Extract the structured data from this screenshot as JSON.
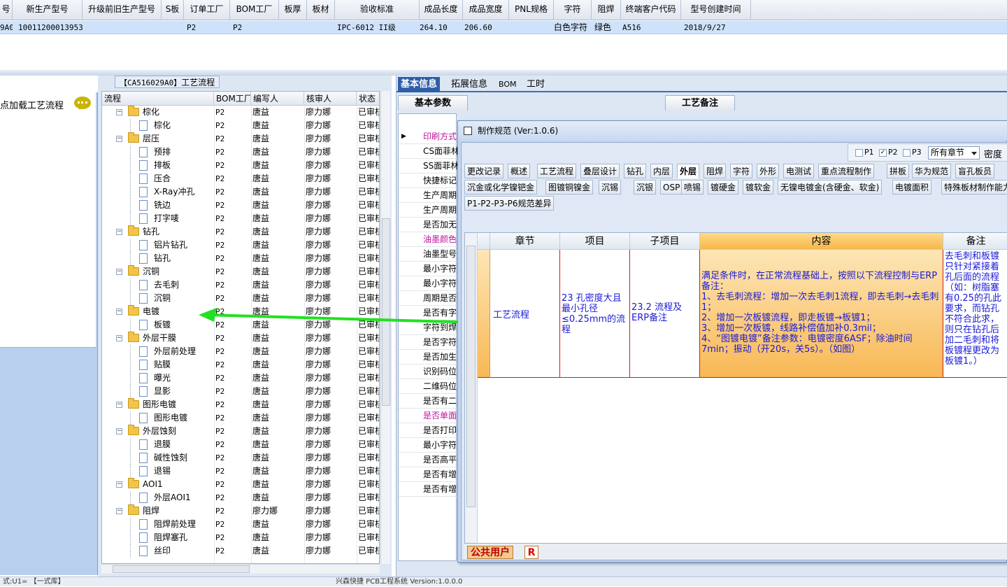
{
  "top_grid": {
    "headers": [
      "号",
      "新生产型号",
      "升级前旧生产型号",
      "S板",
      "订单工厂",
      "BOM工厂",
      "板厚",
      "板材",
      "验收标准",
      "成品长度",
      "成品宽度",
      "PNL规格",
      "字符",
      "阻焊",
      "终端客户代码",
      "型号创建时间"
    ],
    "row": [
      "9A0",
      "10011200013953",
      "",
      "",
      "P2",
      "P2",
      "",
      "",
      "IPC-6012 II级",
      "264.10",
      "206.60",
      "",
      "白色字符",
      "绿色",
      "A516",
      "2018/9/27"
    ]
  },
  "left_panel": {
    "title": "点加载工艺流程"
  },
  "tree": {
    "caption_code": "【CA516029A0】",
    "caption_text": "工艺流程",
    "headers": [
      "流程",
      "BOM工厂",
      "编写人",
      "核审人",
      "状态"
    ],
    "rows": [
      {
        "name": "棕化",
        "type": "folder",
        "bom": "P2",
        "writer": "唐益",
        "reviewer": "廖力娜",
        "status": "已审核"
      },
      {
        "name": "棕化",
        "type": "doc",
        "bom": "P2",
        "writer": "唐益",
        "reviewer": "廖力娜",
        "status": "已审核"
      },
      {
        "name": "层压",
        "type": "folder",
        "bom": "P2",
        "writer": "唐益",
        "reviewer": "廖力娜",
        "status": "已审核"
      },
      {
        "name": "预排",
        "type": "doc",
        "bom": "P2",
        "writer": "唐益",
        "reviewer": "廖力娜",
        "status": "已审核"
      },
      {
        "name": "排板",
        "type": "doc",
        "bom": "P2",
        "writer": "唐益",
        "reviewer": "廖力娜",
        "status": "已审核"
      },
      {
        "name": "压合",
        "type": "doc",
        "bom": "P2",
        "writer": "唐益",
        "reviewer": "廖力娜",
        "status": "已审核"
      },
      {
        "name": "X-Ray冲孔",
        "type": "doc",
        "bom": "P2",
        "writer": "唐益",
        "reviewer": "廖力娜",
        "status": "已审核"
      },
      {
        "name": "铣边",
        "type": "doc",
        "bom": "P2",
        "writer": "唐益",
        "reviewer": "廖力娜",
        "status": "已审核"
      },
      {
        "name": "打字唛",
        "type": "doc",
        "bom": "P2",
        "writer": "唐益",
        "reviewer": "廖力娜",
        "status": "已审核"
      },
      {
        "name": "钻孔",
        "type": "folder",
        "bom": "P2",
        "writer": "唐益",
        "reviewer": "廖力娜",
        "status": "已审核"
      },
      {
        "name": "铝片钻孔",
        "type": "doc",
        "bom": "P2",
        "writer": "唐益",
        "reviewer": "廖力娜",
        "status": "已审核"
      },
      {
        "name": "钻孔",
        "type": "doc",
        "bom": "P2",
        "writer": "唐益",
        "reviewer": "廖力娜",
        "status": "已审核"
      },
      {
        "name": "沉铜",
        "type": "folder",
        "bom": "P2",
        "writer": "唐益",
        "reviewer": "廖力娜",
        "status": "已审核"
      },
      {
        "name": "去毛刺",
        "type": "doc",
        "bom": "P2",
        "writer": "唐益",
        "reviewer": "廖力娜",
        "status": "已审核"
      },
      {
        "name": "沉铜",
        "type": "doc",
        "bom": "P2",
        "writer": "唐益",
        "reviewer": "廖力娜",
        "status": "已审核"
      },
      {
        "name": "电镀",
        "type": "folder",
        "bom": "P2",
        "writer": "唐益",
        "reviewer": "廖力娜",
        "status": "已审核"
      },
      {
        "name": "板镀",
        "type": "doc",
        "bom": "P2",
        "writer": "唐益",
        "reviewer": "廖力娜",
        "status": "已审核"
      },
      {
        "name": "外层干膜",
        "type": "folder",
        "bom": "P2",
        "writer": "唐益",
        "reviewer": "廖力娜",
        "status": "已审核"
      },
      {
        "name": "外层前处理",
        "type": "doc",
        "bom": "P2",
        "writer": "唐益",
        "reviewer": "廖力娜",
        "status": "已审核"
      },
      {
        "name": "贴膜",
        "type": "doc",
        "bom": "P2",
        "writer": "唐益",
        "reviewer": "廖力娜",
        "status": "已审核"
      },
      {
        "name": "曝光",
        "type": "doc",
        "bom": "P2",
        "writer": "唐益",
        "reviewer": "廖力娜",
        "status": "已审核"
      },
      {
        "name": "显影",
        "type": "doc",
        "bom": "P2",
        "writer": "唐益",
        "reviewer": "廖力娜",
        "status": "已审核"
      },
      {
        "name": "图形电镀",
        "type": "folder",
        "bom": "P2",
        "writer": "唐益",
        "reviewer": "廖力娜",
        "status": "已审核"
      },
      {
        "name": "图形电镀",
        "type": "doc",
        "bom": "P2",
        "writer": "唐益",
        "reviewer": "廖力娜",
        "status": "已审核"
      },
      {
        "name": "外层蚀刻",
        "type": "folder",
        "bom": "P2",
        "writer": "唐益",
        "reviewer": "廖力娜",
        "status": "已审核"
      },
      {
        "name": "退膜",
        "type": "doc",
        "bom": "P2",
        "writer": "唐益",
        "reviewer": "廖力娜",
        "status": "已审核"
      },
      {
        "name": "碱性蚀刻",
        "type": "doc",
        "bom": "P2",
        "writer": "唐益",
        "reviewer": "廖力娜",
        "status": "已审核"
      },
      {
        "name": "退锡",
        "type": "doc",
        "bom": "P2",
        "writer": "唐益",
        "reviewer": "廖力娜",
        "status": "已审核"
      },
      {
        "name": "AOI1",
        "type": "folder",
        "bom": "P2",
        "writer": "唐益",
        "reviewer": "廖力娜",
        "status": "已审核"
      },
      {
        "name": "外层AOI1",
        "type": "doc",
        "bom": "P2",
        "writer": "唐益",
        "reviewer": "廖力娜",
        "status": "已审核"
      },
      {
        "name": "阻焊",
        "type": "folder",
        "bom": "P2",
        "writer": "廖力娜",
        "reviewer": "廖力娜",
        "status": "已审核"
      },
      {
        "name": "阻焊前处理",
        "type": "doc",
        "bom": "P2",
        "writer": "唐益",
        "reviewer": "廖力娜",
        "status": "已审核"
      },
      {
        "name": "阻焊塞孔",
        "type": "doc",
        "bom": "P2",
        "writer": "唐益",
        "reviewer": "廖力娜",
        "status": "已审核"
      },
      {
        "name": "丝印",
        "type": "doc",
        "bom": "P2",
        "writer": "唐益",
        "reviewer": "廖力娜",
        "status": "已审核"
      }
    ]
  },
  "right_panel": {
    "tabs": [
      "基本信息",
      "拓展信息",
      "BOM",
      "工时"
    ],
    "subtab_basic": "基本参数",
    "subtab_remark": "工艺备注",
    "basic_rows": [
      {
        "label": "印刷方式",
        "color": "#c0149c"
      },
      {
        "label": "CS面菲林",
        "color": "#000"
      },
      {
        "label": "SS面菲林",
        "color": "#000"
      },
      {
        "label": "快捷标记",
        "color": "#000"
      },
      {
        "label": "生产周期",
        "color": "#000"
      },
      {
        "label": "生产周期",
        "color": "#000"
      },
      {
        "label": "是否加无",
        "color": "#000"
      },
      {
        "label": "油墨颜色",
        "color": "#c0149c"
      },
      {
        "label": "油墨型号",
        "color": "#000"
      },
      {
        "label": "最小字符",
        "color": "#000"
      },
      {
        "label": "最小字符",
        "color": "#000"
      },
      {
        "label": "周期是否",
        "color": "#000"
      },
      {
        "label": "是否有字",
        "color": "#000"
      },
      {
        "label": "字符到焊",
        "color": "#000"
      },
      {
        "label": "是否字符",
        "color": "#000"
      },
      {
        "label": "是否加生",
        "color": "#000"
      },
      {
        "label": "识别码位",
        "color": "#000"
      },
      {
        "label": "二维码位",
        "color": "#000"
      },
      {
        "label": "是否有二",
        "color": "#000"
      },
      {
        "label": "是否单面",
        "color": "#c0149c"
      },
      {
        "label": "是否打印",
        "color": "#000"
      },
      {
        "label": "最小字符",
        "color": "#000"
      },
      {
        "label": "是否高平",
        "color": "#000"
      },
      {
        "label": "是否有增",
        "color": "#000"
      },
      {
        "label": "是否有增",
        "color": "#000"
      }
    ]
  },
  "dialog": {
    "title": "制作规范 (Ver:1.0.6)",
    "filters": {
      "p1": "P1",
      "p2": "P2",
      "p3": "P3",
      "p2_checked": true,
      "chapter": "所有章节",
      "density": "密度"
    },
    "tabs_row1": [
      "更改记录",
      "概述",
      "工艺流程",
      "叠层设计",
      "钻孔",
      "内层",
      "外层",
      "阻焊",
      "字符",
      "外形",
      "电测试",
      "重点流程制作",
      "拼板",
      "华为规范",
      "盲孔板员"
    ],
    "active_tab": "外层",
    "tabs_row2": [
      "沉金或化学镍钯金",
      "图镀铜镍金",
      "沉锡",
      "沉银",
      "OSP",
      "喷锡",
      "镀硬金",
      "镀软金",
      "无镍电镀金(含硬金、软金)",
      "电镀面积",
      "特殊板材制作能力"
    ],
    "tabs_row3": [
      "P1-P2-P3-P6规范差异"
    ],
    "table_headers": [
      "章节",
      "项目",
      "子项目",
      "内容",
      "备注"
    ],
    "row": {
      "chapter": "工艺流程",
      "item": "23 孔密度大且最小孔径≤0.25mm的流程",
      "subitem": "23.2 流程及ERP备注",
      "content": "满足条件时，在正常流程基础上，按照以下流程控制与ERP备注：\n1、去毛刺流程：增加一次去毛刺1流程，即去毛刺→去毛刺1；\n2、增加一次板镀流程，即走板镀→板镀1；\n3、增加一次板镀，线路补偿值加补0.3mil；\n4、“图镀电镀”备注参数：电镀密度6ASF；除油时间7min；振动（开20s，关5s）。（如图）",
      "remark": "去毛刺和板镀只针对紧接着孔后面的流程（如：树脂塞有0.25的孔此要求，而钻孔不符合此求，则只在钻孔后加二毛刺和将板镀程更改为板镀1。）"
    },
    "status_user": "公共用户",
    "status_r": "R"
  },
  "colors": {
    "annotation_arrow": "#22e022",
    "accent": "#2f5ea8"
  },
  "status_bar": {
    "left": "式:U1=  【一式库】",
    "center": "兴森快捷 PCB工程系统 Version:1.0.0.0"
  }
}
